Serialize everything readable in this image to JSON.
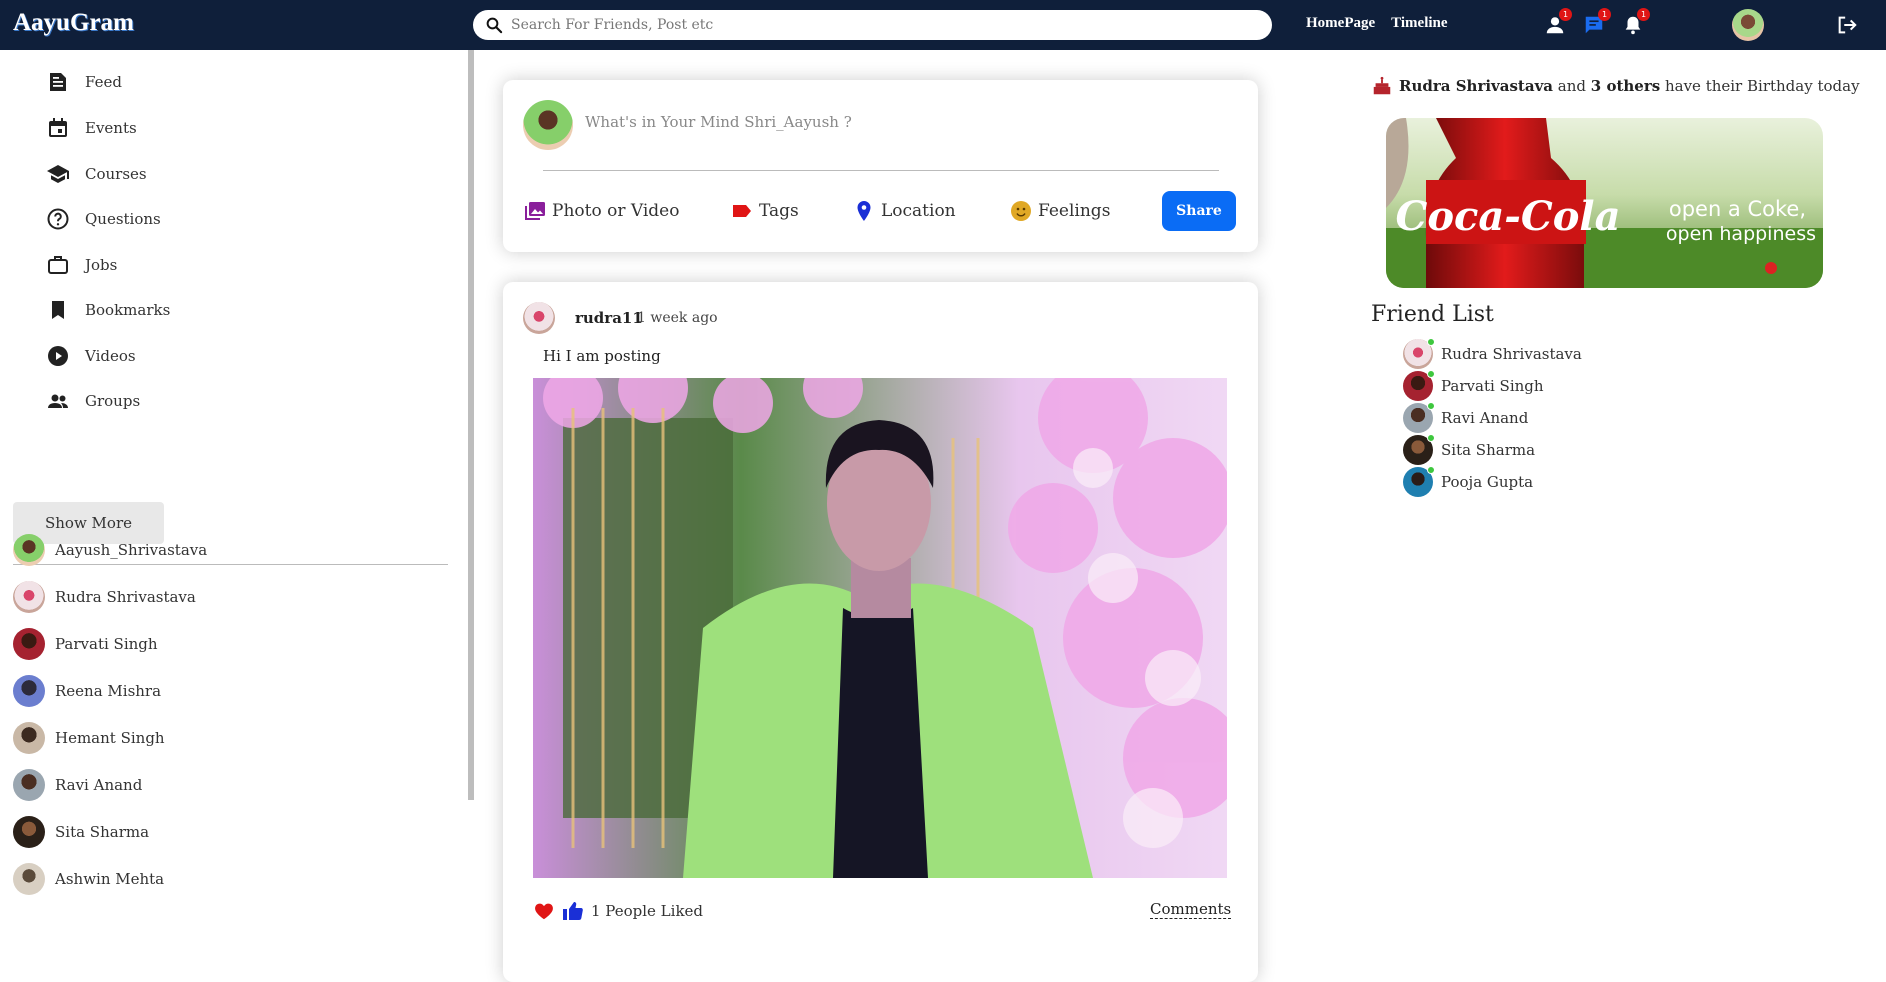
{
  "app": {
    "logo": "AayuGram"
  },
  "search": {
    "placeholder": "Search For Friends, Post etc"
  },
  "nav": {
    "links": [
      "HomePage",
      "Timeline"
    ]
  },
  "notifications": {
    "friends_badge": "1",
    "messages_badge": "1",
    "alerts_badge": "1"
  },
  "sidebar": {
    "menu": [
      {
        "label": "Feed",
        "icon": "feed-icon"
      },
      {
        "label": "Events",
        "icon": "calendar-icon"
      },
      {
        "label": "Courses",
        "icon": "school-icon"
      },
      {
        "label": "Questions",
        "icon": "help-icon"
      },
      {
        "label": "Jobs",
        "icon": "briefcase-icon"
      },
      {
        "label": "Bookmarks",
        "icon": "bookmark-icon"
      },
      {
        "label": "Videos",
        "icon": "play-icon"
      },
      {
        "label": "Groups",
        "icon": "group-icon"
      }
    ],
    "show_more": "Show More",
    "friends": [
      "Aayush_Shrivastava",
      "Rudra Shrivastava",
      "Parvati Singh",
      "Reena Mishra",
      "Hemant Singh",
      "Ravi Anand",
      "Sita Sharma",
      "Ashwin Mehta"
    ]
  },
  "share": {
    "placeholder": "What's in Your Mind Shri_Aayush ?",
    "options": [
      "Photo or Video",
      "Tags",
      "Location",
      "Feelings"
    ],
    "button": "Share",
    "colors": {
      "photo": "#8a1f9b",
      "tags": "#e01515",
      "location": "#1a2fd6",
      "feelings": "#e0a825",
      "button": "#0a6cf5"
    }
  },
  "post": {
    "username": "rudra11",
    "time": "1 week ago",
    "text": "Hi I am posting",
    "likes": "1 People Liked",
    "comments": "Comments"
  },
  "right": {
    "birthday": {
      "name": "Rudra Shrivastava",
      "mid": "and",
      "others": "3 others",
      "tail": "have their Birthday today"
    },
    "ad": {
      "brand": "Coca-Cola",
      "slogan_1": "open a Coke,",
      "slogan_2": "open happiness"
    },
    "friend_list_title": "Friend List",
    "friends": [
      "Rudra Shrivastava",
      "Parvati Singh",
      "Ravi Anand",
      "Sita Sharma",
      "Pooja Gupta"
    ]
  }
}
